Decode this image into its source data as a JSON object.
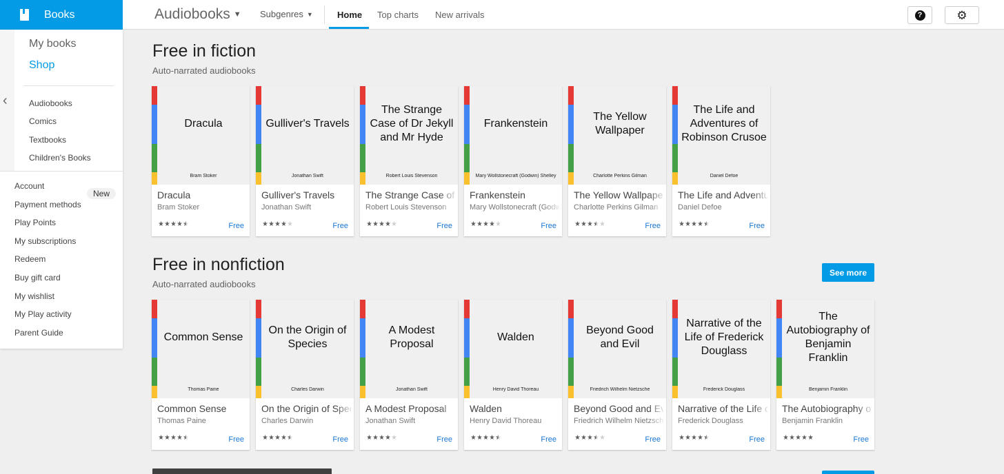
{
  "brand": {
    "label": "Books"
  },
  "topnav": {
    "category": "Audiobooks",
    "subgenres": "Subgenres",
    "tabs": [
      {
        "label": "Home",
        "active": true
      },
      {
        "label": "Top charts",
        "active": false
      },
      {
        "label": "New arrivals",
        "active": false
      }
    ],
    "help_glyph": "?",
    "gear_glyph": "⚙"
  },
  "leftnav": {
    "my_books": "My books",
    "shop": "Shop",
    "categories": [
      "Audiobooks",
      "Comics",
      "Textbooks",
      "Children's Books"
    ],
    "account": [
      "Account",
      "Payment methods",
      "Play Points",
      "My subscriptions",
      "Redeem",
      "Buy gift card",
      "My wishlist",
      "My Play activity",
      "Parent Guide"
    ],
    "new_badge": "New"
  },
  "colors": {
    "accent": "#039be5",
    "price": "#1976d2"
  },
  "sections": [
    {
      "title": "Free in fiction",
      "subtitle": "Auto-narrated audiobooks",
      "see_more": "",
      "books": [
        {
          "cover_title": "Dracula",
          "title": "Dracula",
          "author": "Bram Stoker",
          "rating": 4.5,
          "price": "Free"
        },
        {
          "cover_title": "Gulliver's Travels",
          "title": "Gulliver's Travels",
          "author": "Jonathan Swift",
          "rating": 4,
          "price": "Free"
        },
        {
          "cover_title": "The Strange Case of Dr Jekyll and Mr Hyde",
          "title": "The Strange Case of Dr Jekyll and Mr Hyde",
          "author": "Robert Louis Stevenson",
          "rating": 4,
          "price": "Free"
        },
        {
          "cover_title": "Frankenstein",
          "title": "Frankenstein",
          "author": "Mary Wollstonecraft (Godwin) Shelley",
          "rating": 4,
          "price": "Free"
        },
        {
          "cover_title": "The Yellow Wallpaper",
          "title": "The Yellow Wallpaper",
          "author": "Charlotte Perkins Gilman",
          "rating": 3.5,
          "price": "Free"
        },
        {
          "cover_title": "The Life and Adventures of Robinson Crusoe",
          "title": "The Life and Adventures of Robinson Crusoe",
          "author": "Daniel Defoe",
          "rating": 4.5,
          "price": "Free"
        }
      ]
    },
    {
      "title": "Free in nonfiction",
      "subtitle": "Auto-narrated audiobooks",
      "see_more": "See more",
      "books": [
        {
          "cover_title": "Common Sense",
          "title": "Common Sense",
          "author": "Thomas Paine",
          "rating": 4.5,
          "price": "Free"
        },
        {
          "cover_title": "On the Origin of Species",
          "title": "On the Origin of Species",
          "author": "Charles Darwin",
          "rating": 4.5,
          "price": "Free"
        },
        {
          "cover_title": "A Modest Proposal",
          "title": "A Modest Proposal",
          "author": "Jonathan Swift",
          "rating": 4,
          "price": "Free"
        },
        {
          "cover_title": "Walden",
          "title": "Walden",
          "author": "Henry David Thoreau",
          "rating": 4.5,
          "price": "Free"
        },
        {
          "cover_title": "Beyond Good and Evil",
          "title": "Beyond Good and Evil",
          "author": "Friedrich Wilhelm Nietzsche",
          "rating": 3.5,
          "price": "Free"
        },
        {
          "cover_title": "Narrative of the Life of Frederick Douglass",
          "title": "Narrative of the Life of Frederick Douglass",
          "author": "Frederick Douglass",
          "rating": 4.5,
          "price": "Free"
        },
        {
          "cover_title": "The Autobiography of Benjamin Franklin",
          "title": "The Autobiography of Benjamin Franklin",
          "author": "Benjamin Franklin",
          "rating": 5,
          "price": "Free"
        }
      ]
    }
  ]
}
